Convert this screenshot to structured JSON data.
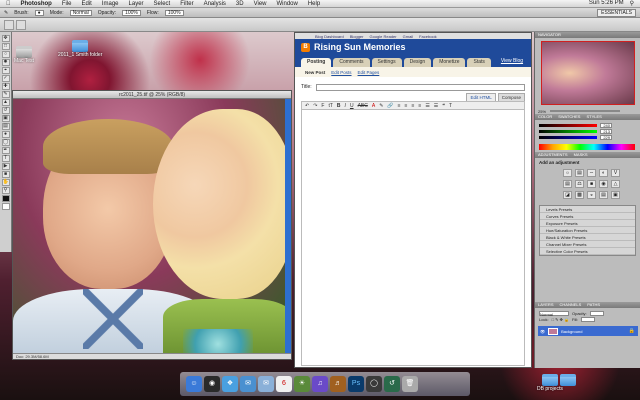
{
  "menubar": {
    "apple": "",
    "app_name": "Photoshop",
    "menus": [
      "File",
      "Edit",
      "Image",
      "Layer",
      "Select",
      "Filter",
      "Analysis",
      "3D",
      "View",
      "Window",
      "Help"
    ],
    "clock": "Sun 5:26 PM"
  },
  "optionsbar": {
    "brush_label": "Brush:",
    "mode_label": "Mode:",
    "mode_value": "Normal",
    "opacity_label": "Opacity:",
    "opacity_value": "100%",
    "flow_label": "Flow:",
    "flow_value": "100%",
    "workspace": "ESSENTIALS"
  },
  "desktop": {
    "icons": [
      {
        "label": "2011_1 Smith folder"
      },
      {
        "label": "Mac Test"
      }
    ],
    "db_projects": "DB projects"
  },
  "photo_window": {
    "title": "rc2011_25.tif @ 25% (RGB/8)",
    "status": "Doc: 29.3M/58.6M"
  },
  "blogger": {
    "browser_tabs": [
      "Blog Dashboard",
      "Blogger",
      "Google Reader",
      "Gmail",
      "Facebook"
    ],
    "logo": "B",
    "blog_title": "Rising Sun Memories",
    "nav_tabs": [
      {
        "label": "Posting"
      },
      {
        "label": "Comments"
      },
      {
        "label": "Settings"
      },
      {
        "label": "Design"
      },
      {
        "label": "Monetize"
      },
      {
        "label": "Stats"
      }
    ],
    "view_blog": "View Blog",
    "sub_tabs": [
      "New Post",
      "Edit Posts",
      "Edit Pages"
    ],
    "title_label": "Title:",
    "modes": [
      "Edit HTML",
      "Compose"
    ],
    "toolbar": [
      "↶",
      "↷",
      "F",
      "tT",
      "B",
      "I",
      "U",
      "ABC",
      "A",
      "✎",
      "🔗",
      "≡",
      "≡",
      "≡",
      "≡",
      "☰",
      "☰",
      "❝",
      "T"
    ]
  },
  "panels": {
    "navigator": "NAVIGATOR",
    "zoom": "25%",
    "color_tabs": [
      "COLOR",
      "SWATCHES",
      "STYLES"
    ],
    "color_values": [
      "240",
      "213",
      "229"
    ],
    "adjust_tabs": [
      "ADJUSTMENTS",
      "MASKS"
    ],
    "adjust_title": "Add an adjustment",
    "presets": [
      "Levels Presets",
      "Curves Presets",
      "Exposure Presets",
      "Hue/Saturation Presets",
      "Black & White Presets",
      "Channel Mixer Presets",
      "Selective Color Presets"
    ],
    "layers_tabs": [
      "LAYERS",
      "CHANNELS",
      "PATHS"
    ],
    "blend_mode": "Normal",
    "opacity_label": "Opacity:",
    "lock_label": "Lock:",
    "fill_label": "Fill:",
    "layer_name": "Background",
    "lock_icon": "🔒"
  },
  "colors": {
    "blogger_blue": "#1f4a9a",
    "blogger_orange": "#f57d00",
    "selection_blue": "#3a6ad0"
  },
  "dock_icons": [
    "finder-icon",
    "dashboard-icon",
    "safari-icon",
    "ichat-icon",
    "mail-icon",
    "ical-icon",
    "iphoto-icon",
    "itunes-icon",
    "garageband-icon",
    "photoshop-icon",
    "bridge-icon",
    "timemachine-icon",
    "trash-icon"
  ]
}
